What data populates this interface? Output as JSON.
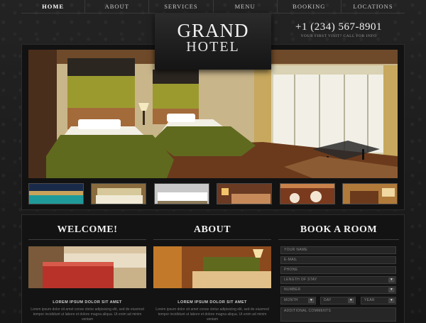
{
  "nav": {
    "items": [
      "HOME",
      "ABOUT",
      "SERVICES",
      "MENU",
      "BOOKING",
      "LOCATIONS"
    ],
    "active": "HOME"
  },
  "logo": {
    "line1": "GRAND",
    "line2": "HOTEL"
  },
  "phone": {
    "number": "+1 (234) 567-8901",
    "subtitle": "YOUR FIRST VISIT? CALL FOR INFO"
  },
  "sections": {
    "welcome": {
      "title": "WELCOME!",
      "heading": "LOREM IPSUM DOLOR SIT AMET",
      "text": "Lorem ipsum dolor sit amet conse ctetur adipisicing elit, sed do eiusmod tempor incididunt ut labore et dolore magna aliqua. Ut enim ad minim veniam"
    },
    "about": {
      "title": "ABOUT",
      "heading": "LOREM IPSUM DOLOR SIT AMET",
      "text": "Lorem ipsum dolor sit amet conse ctetur adipisicing elit, sed do eiusmod tempor incididunt ut labore et dolore magna aliqua. Ut enim ad minim veniam"
    },
    "book": {
      "title": "BOOK A ROOM",
      "fields": {
        "name": "YOUR NAME",
        "email": "E-MAIL",
        "phone": "PHONE",
        "length": "LENGTH OF STAY",
        "number": "NUMBER",
        "month": "MONTH",
        "day": "DAY",
        "year": "YEAR",
        "comments": "ADDITIONAL COMMENTS"
      }
    }
  },
  "colors": {
    "background": "#1b1b1b",
    "wall_olive": "#8c8a2f",
    "bedspread": "#5f6a1f",
    "floor_wood": "#6b3a1c",
    "text_light": "#f0f0f0"
  }
}
